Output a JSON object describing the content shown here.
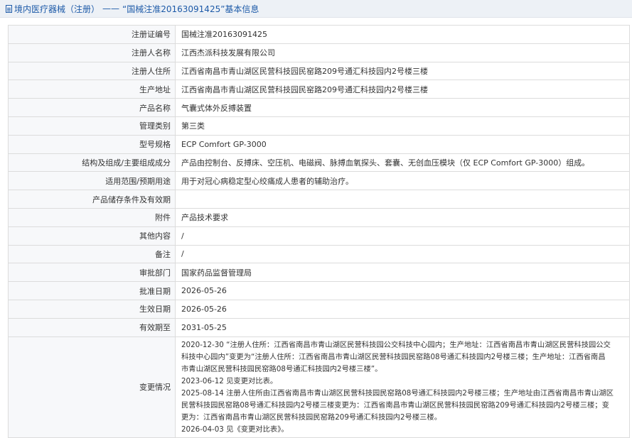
{
  "header": {
    "icon": "document-icon",
    "category": "境内医疗器械（注册）",
    "separator": "——",
    "title": "“国械注准20163091425”基本信息",
    "color": "#1d5aa8"
  },
  "rows": [
    {
      "label": "注册证编号",
      "value": "国械注准20163091425"
    },
    {
      "label": "注册人名称",
      "value": "江西杰派科技发展有限公司"
    },
    {
      "label": "注册人住所",
      "value": "江西省南昌市青山湖区民营科技园民窑路209号通汇科技园内2号楼三楼"
    },
    {
      "label": "生产地址",
      "value": "江西省南昌市青山湖区民营科技园民窑路209号通汇科技园内2号楼三楼"
    },
    {
      "label": "产品名称",
      "value": "气囊式体外反搏装置"
    },
    {
      "label": "管理类别",
      "value": "第三类"
    },
    {
      "label": "型号规格",
      "value": "ECP Comfort GP-3000"
    },
    {
      "label": "结构及组成/主要组成成分",
      "value": "产品由控制台、反搏床、空压机、电磁阀、脉搏血氧探头、套囊、无创血压模块（仅 ECP Comfort GP-3000）组成。"
    },
    {
      "label": "适用范围/预期用途",
      "value": "用于对冠心病稳定型心绞痛成人患者的辅助治疗。"
    },
    {
      "label": "产品储存条件及有效期",
      "value": ""
    },
    {
      "label": "附件",
      "value": "产品技术要求"
    },
    {
      "label": "其他内容",
      "value": "/"
    },
    {
      "label": "备注",
      "value": "/"
    },
    {
      "label": "审批部门",
      "value": "国家药品监督管理局"
    },
    {
      "label": "批准日期",
      "value": "2026-05-26"
    },
    {
      "label": "生效日期",
      "value": "2026-05-26"
    },
    {
      "label": "有效期至",
      "value": "2031-05-25"
    }
  ],
  "changes": {
    "label": "变更情况",
    "lines": [
      "2020-12-30 “注册人住所：江西省南昌市青山湖区民营科技园公交科技中心园内；生产地址：江西省南昌市青山湖区民营科技园公交",
      "科技中心园内”变更为“注册人住所：江西省南昌市青山湖区民营科技园民窑路08号通汇科技园内2号楼三楼；生产地址：江西省南昌",
      "市青山湖区民营科技园民窑路08号通汇科技园内2号楼三楼”。",
      "2023-06-12 见变更对比表。",
      "2025-08-14 注册人住所由江西省南昌市青山湖区民营科技园民窑路08号通汇科技园内2号楼三楼；生产地址由江西省南昌市青山湖区",
      "民营科技园民窑路08号通汇科技园内2号楼三楼变更为：江西省南昌市青山湖区民营科技园民窑路209号通汇科技园内2号楼三楼；变",
      "更为：江西省南昌市青山湖区民营科技园民窑路209号通汇科技园内2号楼三楼。",
      "2026-04-03 见《变更对比表》。"
    ]
  }
}
